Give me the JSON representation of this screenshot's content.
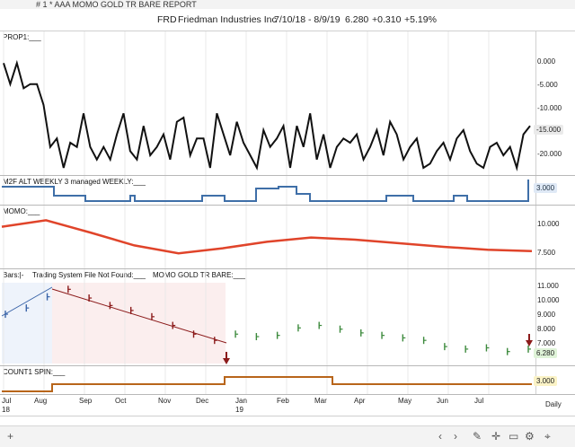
{
  "window": {
    "title": "# 1 *  AAA MOMO GOLD TR BARE  REPORT"
  },
  "quote": {
    "symbol": "FRD",
    "name": "Friedman Industries Inc",
    "range": "7/10/18 - 8/9/19",
    "last": "6.280",
    "change": "+0.310",
    "pct": "+5.19%"
  },
  "panels": {
    "prop1": {
      "label": "PROP1:___"
    },
    "m2f": {
      "label": "M2F ALT WEEKLY 3 managed WEEKLY:___",
      "current": "3.000"
    },
    "momo": {
      "label": "MOMO:___"
    },
    "bars": {
      "label1": "Bars:|-",
      "label2": "Trading System File Not Found:___",
      "label3": "MOMO GOLD TR BARE:___",
      "current": "6.280"
    },
    "count1": {
      "label": "COUNT1 SPIN:___",
      "current": "3.000"
    }
  },
  "time_axis": {
    "months": [
      "Jul",
      "Aug",
      "Sep",
      "Oct",
      "Nov",
      "Dec",
      "Jan",
      "Feb",
      "Mar",
      "Apr",
      "May",
      "Jun",
      "Jul"
    ],
    "years": [
      "18",
      "19"
    ],
    "period": "Daily"
  },
  "colors": {
    "line": "#111111",
    "step": "#3f6fa8",
    "momo": "#e0442a",
    "down": "#8b1a1a",
    "up": "#3c8a3c",
    "early": "#3a64a8",
    "count": "#b8651a",
    "green_tag": "#dff3d8",
    "yellow_tag": "#fbf3c6"
  },
  "chart_data": [
    {
      "type": "line",
      "title": "PROP1",
      "ylim": [
        -25,
        5
      ],
      "yticks": [
        "0.000",
        "-5.000",
        "-10.000",
        "-15.000",
        "-20.000"
      ],
      "current": "-15.000",
      "values": [
        0,
        -5,
        0,
        -6,
        -5,
        -5,
        -10,
        -20,
        -18,
        -25,
        -19,
        -20,
        -12,
        -20,
        -23,
        -20,
        -23,
        -17,
        -12,
        -21,
        -23,
        -15,
        -22,
        -20,
        -17,
        -23,
        -14,
        -13,
        -22,
        -18,
        -18,
        -25,
        -12,
        -17,
        -22,
        -14,
        -19,
        -22,
        -25,
        -16,
        -20,
        -18,
        -15,
        -25,
        -15,
        -20,
        -12,
        -23,
        -17,
        -25,
        -20,
        -18,
        -19,
        -17,
        -23,
        -20,
        -16,
        -22,
        -14,
        -17,
        -23,
        -20,
        -18,
        -25,
        -24,
        -21,
        -19,
        -23,
        -18,
        -16,
        -21,
        -24,
        -25,
        -20,
        -19,
        -22,
        -20,
        -25,
        -17,
        -15
      ]
    },
    {
      "type": "line",
      "title": "MOMO",
      "ylim": [
        5,
        12.5
      ],
      "yticks": [
        "10.000",
        "7.500"
      ],
      "values": [
        10.3,
        11.2,
        9.5,
        7.7,
        6.6,
        7.3,
        8.2,
        8.8,
        8.5,
        8.0,
        7.5,
        7.1,
        6.9
      ]
    },
    {
      "type": "bar",
      "title": "MOMO GOLD TR BARE",
      "ylim": [
        5.5,
        11.7
      ],
      "yticks": [
        "11.000",
        "10.000",
        "9.000",
        "8.000",
        "7.000"
      ],
      "values": [
        9.1,
        9.6,
        10.5,
        11.1,
        10.4,
        9.8,
        9.4,
        8.9,
        8.2,
        7.5,
        7.0,
        7.5,
        7.3,
        7.4,
        8.0,
        8.2,
        7.9,
        7.6,
        7.4,
        7.2,
        7.0,
        6.5,
        6.3,
        6.4,
        6.1,
        6.3
      ]
    },
    {
      "type": "line",
      "title": "COUNT1 SPIN",
      "ylim": [
        0,
        5
      ],
      "yticks": [],
      "values": [
        1,
        3,
        3,
        3,
        3,
        3,
        4,
        4,
        4,
        4,
        3,
        3,
        3,
        3
      ]
    }
  ]
}
